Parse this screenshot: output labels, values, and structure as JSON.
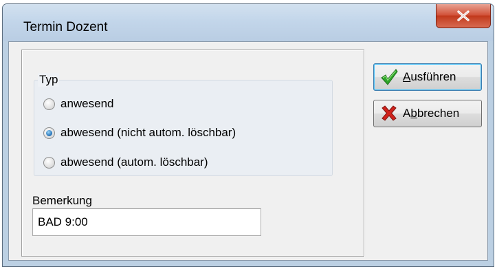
{
  "window": {
    "title": "Termin Dozent"
  },
  "form": {
    "typ_group": {
      "legend": "Typ",
      "options": [
        {
          "label": "anwesend",
          "selected": false
        },
        {
          "label": "abwesend (nicht autom. löschbar)",
          "selected": true
        },
        {
          "label": "abwesend (autom. löschbar)",
          "selected": false
        }
      ]
    },
    "bemerkung": {
      "label": "Bemerkung",
      "value": "BAD 9:00"
    }
  },
  "buttons": {
    "execute": {
      "label_accel": "A",
      "label_rest": "usführen",
      "icon": "checkmark-icon"
    },
    "cancel": {
      "label_pre": "A",
      "label_accel": "b",
      "label_rest": "brechen",
      "icon": "cross-icon"
    }
  },
  "colors": {
    "selected_radio": "#2673b8",
    "default_button_border": "#3c7fb1",
    "close_button": "#c1391c",
    "check_green": "#2ea52a",
    "cross_red": "#d0221c"
  }
}
